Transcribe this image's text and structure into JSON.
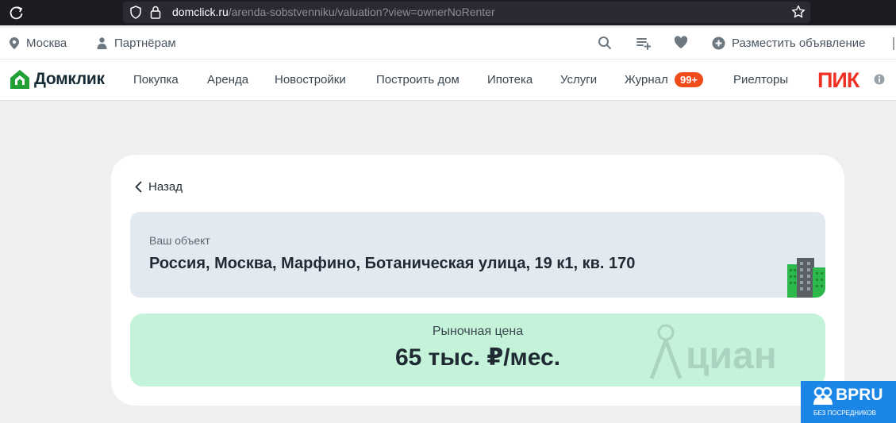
{
  "browser": {
    "url_host": "domclick.ru",
    "url_path": "/arenda-sobstvenniku/valuation?view=ownerNoRenter"
  },
  "topbar": {
    "city": "Москва",
    "partners": "Партнёрам",
    "post_ad": "Разместить объявление"
  },
  "nav": {
    "logo": "Домклик",
    "items": [
      "Покупка",
      "Аренда",
      "Новостройки",
      "Построить дом",
      "Ипотека",
      "Услуги",
      "Журнал",
      "Риелторы"
    ],
    "journal_badge": "99+",
    "partner_logo": "ПИК"
  },
  "card": {
    "back": "Назад",
    "object_label": "Ваш объект",
    "object_address": "Россия, Москва, Марфино, Ботаническая улица, 19 к1, кв. 170",
    "price_label": "Рыночная цена",
    "price_value": "65 тыс. ₽/мес."
  },
  "watermark": {
    "brand": "циан"
  },
  "corner_badge": {
    "title": "BPRU",
    "subtitle": "БЕЗ ПОСРЕДНИКОВ"
  },
  "colors": {
    "accent_green": "#21a038",
    "badge_orange": "#ef4b1b",
    "pik_red": "#ef3124",
    "price_bg": "#c4f3da",
    "object_bg": "#e3e9f1",
    "bpru_blue": "#1c86e6"
  },
  "icons": [
    "reload-icon",
    "shield-icon",
    "lock-icon",
    "bookmark-star-icon",
    "location-pin-icon",
    "partner-person-icon",
    "search-icon",
    "compare-list-icon",
    "heart-icon",
    "plus-circle-icon",
    "chevron-left-icon",
    "building-icon",
    "info-icon"
  ]
}
